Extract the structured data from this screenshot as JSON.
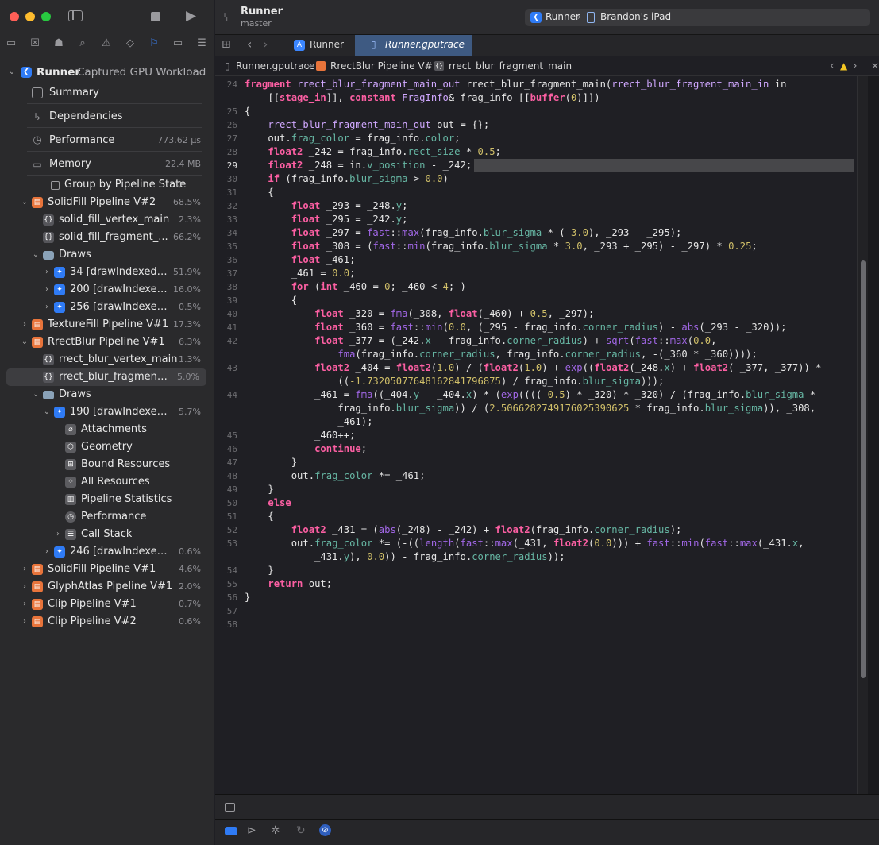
{
  "project": {
    "name": "Runner",
    "branch": "master"
  },
  "scheme": {
    "target": "Runner",
    "device": "Brandon's iPad"
  },
  "tabs": [
    {
      "label": "Runner",
      "active": false
    },
    {
      "label": "Runner.gputrace",
      "active": true
    }
  ],
  "breadcrumb": [
    "Runner.gputrace",
    "RrectBlur Pipeline V#1",
    "rrect_blur_fragment_main"
  ],
  "workload": {
    "app": "Runner",
    "title": "Captured GPU Workload"
  },
  "overview": [
    {
      "label": "Summary",
      "value": ""
    },
    {
      "label": "Dependencies",
      "value": ""
    },
    {
      "label": "Performance",
      "value": "773.62 μs"
    },
    {
      "label": "Memory",
      "value": "22.4 MB"
    }
  ],
  "group_by": "Group by Pipeline State",
  "tree": {
    "solidfill_v2": {
      "label": "SolidFill Pipeline V#2",
      "pct": "68.5%"
    },
    "solid_vertex": {
      "label": "solid_fill_vertex_main",
      "pct": "2.3%"
    },
    "solid_fragment": {
      "label": "solid_fill_fragment_...",
      "pct": "66.2%"
    },
    "draws1": {
      "label": "Draws"
    },
    "draw34": {
      "label": "34 [drawIndexedPr...",
      "pct": "51.9%"
    },
    "draw200": {
      "label": "200 [drawIndexed...",
      "pct": "16.0%"
    },
    "draw256": {
      "label": "256 [drawIndexedP...",
      "pct": "0.5%"
    },
    "texturefill": {
      "label": "TextureFill Pipeline V#1",
      "pct": "17.3%"
    },
    "rrectblur": {
      "label": "RrectBlur Pipeline V#1",
      "pct": "6.3%"
    },
    "rrect_vertex": {
      "label": "rrect_blur_vertex_main",
      "pct": "1.3%"
    },
    "rrect_fragment": {
      "label": "rrect_blur_fragment_...",
      "pct": "5.0%"
    },
    "draws2": {
      "label": "Draws"
    },
    "draw190": {
      "label": "190 [drawIndexedPr...",
      "pct": "5.7%"
    },
    "attachments": {
      "label": "Attachments"
    },
    "geometry": {
      "label": "Geometry"
    },
    "bound": {
      "label": "Bound Resources"
    },
    "allres": {
      "label": "All Resources"
    },
    "pipestats": {
      "label": "Pipeline Statistics"
    },
    "perf2": {
      "label": "Performance"
    },
    "callstack": {
      "label": "Call Stack"
    },
    "draw246": {
      "label": "246 [drawIndexedP...",
      "pct": "0.6%"
    },
    "solidfill_v1": {
      "label": "SolidFill Pipeline V#1",
      "pct": "4.6%"
    },
    "glyph": {
      "label": "GlyphAtlas Pipeline V#1",
      "pct": "2.0%"
    },
    "clip1": {
      "label": "Clip Pipeline V#1",
      "pct": "0.7%"
    },
    "clip2": {
      "label": "Clip Pipeline V#2",
      "pct": "0.6%"
    }
  },
  "line_numbers": [
    "24",
    "",
    "25",
    "26",
    "27",
    "28",
    "29",
    "30",
    "31",
    "32",
    "33",
    "34",
    "35",
    "36",
    "37",
    "38",
    "39",
    "40",
    "41",
    "42",
    "",
    "43",
    "",
    "44",
    "",
    "",
    "45",
    "46",
    "47",
    "48",
    "49",
    "50",
    "51",
    "52",
    "53",
    "",
    "54",
    "55",
    "56",
    "57",
    "58"
  ],
  "colors": {
    "accent": "#2f7bf5",
    "pipeline": "#e8743b",
    "keyword": "#fc5fa3",
    "number": "#d0bf69",
    "function": "#a167e6"
  }
}
